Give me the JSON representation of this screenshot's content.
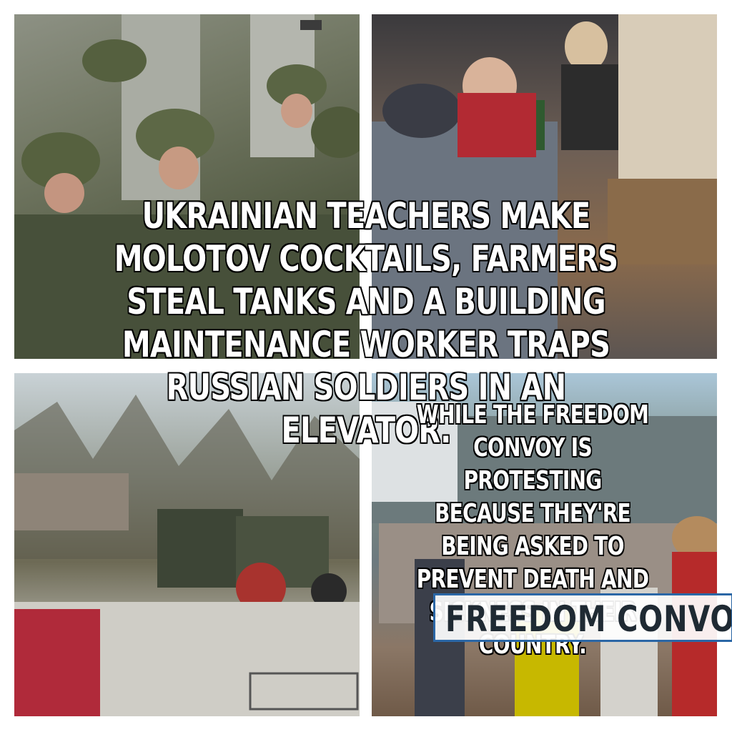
{
  "caption_main": "UKRAINIAN TEACHERS MAKE MOLOTOV COCKTAILS, FARMERS STEAL TANKS AND A BUILDING MAINTENANCE WORKER TRAPS RUSSIAN SOLDIERS IN AN ELEVATOR.",
  "caption_secondary": "WHILE THE FREEDOM CONVOY IS PROTESTING BECAUSE THEY'RE BEING ASKED TO PREVENT DEATH AND SICKNESS IN THEIR COUNTRY.",
  "news_banner": "FREEDOM CONVOY",
  "colors": {
    "caption_text": "#ffffff",
    "caption_outline": "#000000",
    "banner_border": "#2b67a6",
    "banner_text": "#1f2a33"
  }
}
